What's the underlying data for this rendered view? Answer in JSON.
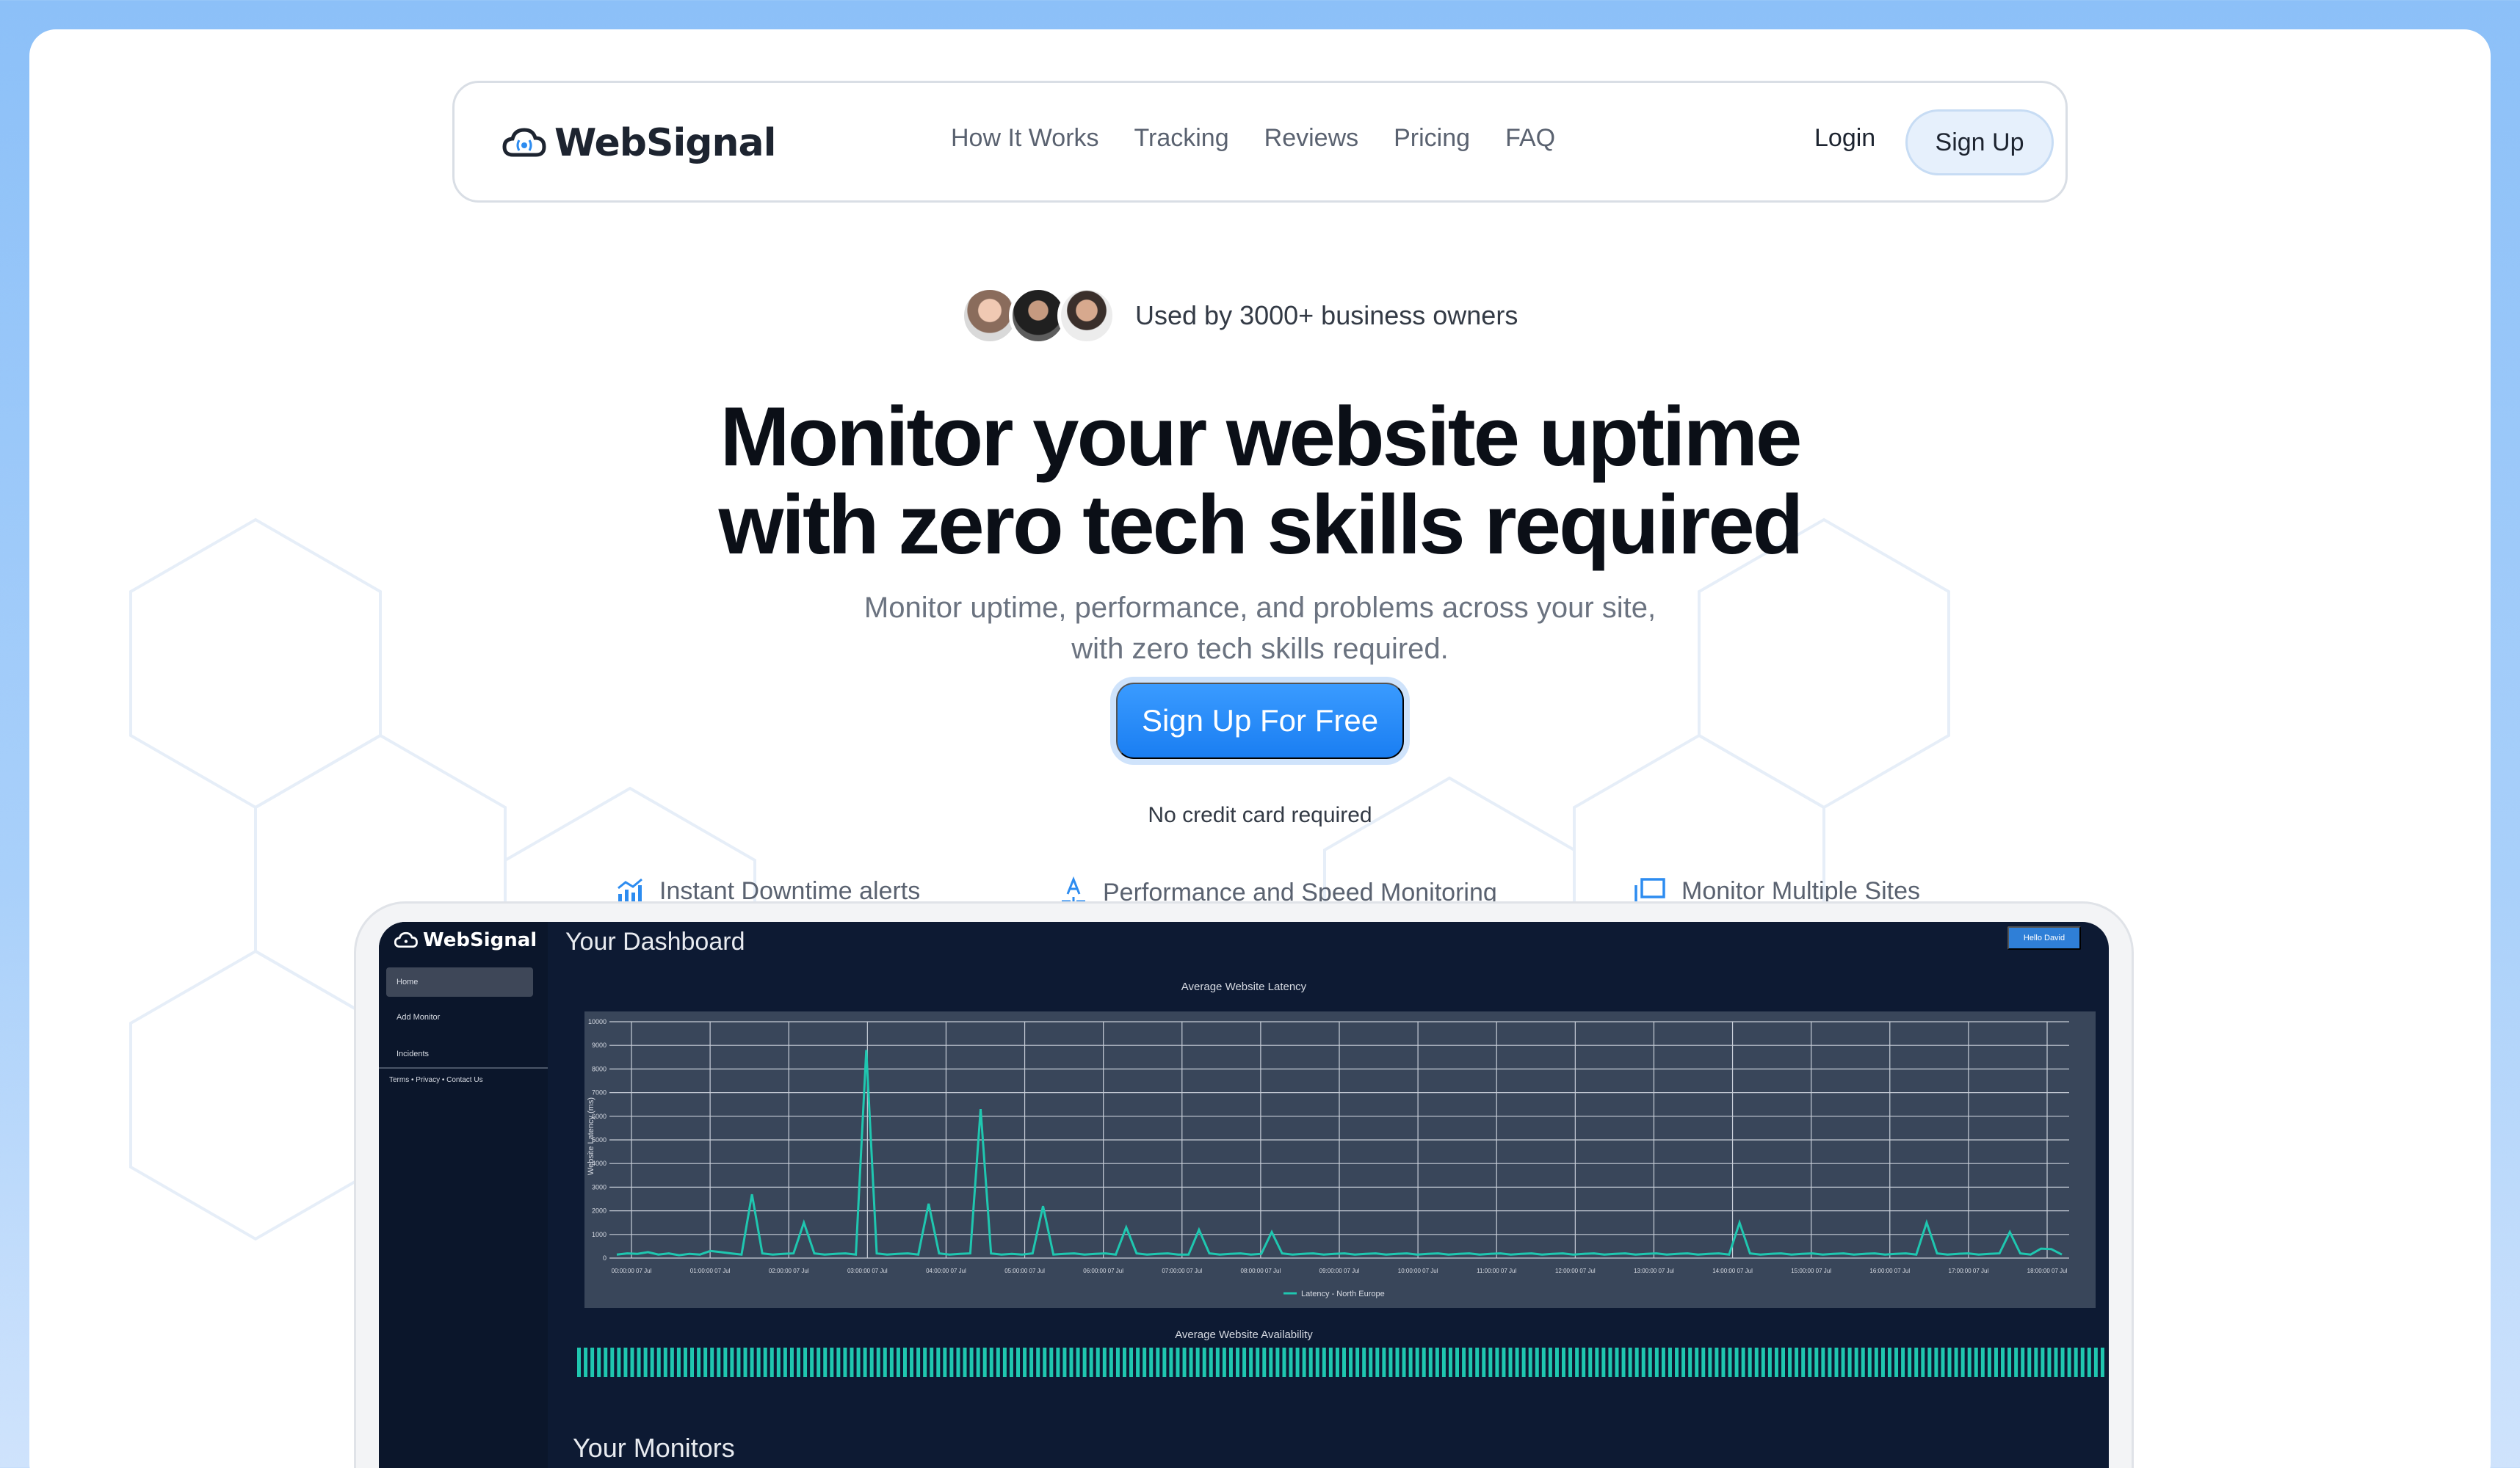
{
  "brand": {
    "name": "WebSignal"
  },
  "nav": {
    "links": [
      "How It Works",
      "Tracking",
      "Reviews",
      "Pricing",
      "FAQ"
    ],
    "login": "Login",
    "signup": "Sign Up"
  },
  "hero": {
    "social_proof": "Used by 3000+ business owners",
    "headline_line1": "Monitor your website uptime",
    "headline_line2": "with zero tech skills required",
    "subhead": "Monitor uptime, performance, and problems across your site, with zero tech skills required.",
    "cta": "Sign Up For Free",
    "cta_note": "No credit card required"
  },
  "features": [
    {
      "icon": "chart-bar-icon",
      "label": "Instant Downtime alerts"
    },
    {
      "icon": "speed-icon",
      "label": "Performance and Speed Monitoring"
    },
    {
      "icon": "windows-icon",
      "label": "Monitor Multiple Sites"
    }
  ],
  "dashboard": {
    "logo": "WebSignal",
    "title": "Your Dashboard",
    "hello": "Hello David",
    "sidebar": [
      "Home",
      "Add Monitor",
      "Incidents"
    ],
    "footer_links": "Terms • Privacy • Contact Us",
    "availability_title": "Average Website Availability",
    "monitors_title": "Your Monitors"
  },
  "colors": {
    "accent": "#1a7ef2",
    "line": "#1fc7b0",
    "dashboard_bg": "#0d1a33"
  },
  "chart_data": {
    "type": "line",
    "title": "Average Website Latency",
    "ylabel": "Website Latency (ms)",
    "xlabel": "",
    "ylim": [
      0,
      10000
    ],
    "yticks": [
      0,
      1000,
      2000,
      3000,
      4000,
      5000,
      6000,
      7000,
      8000,
      9000,
      10000
    ],
    "categories": [
      "00:00:00 07 Jul",
      "01:00:00 07 Jul",
      "02:00:00 07 Jul",
      "03:00:00 07 Jul",
      "04:00:00 07 Jul",
      "05:00:00 07 Jul",
      "06:00:00 07 Jul",
      "07:00:00 07 Jul",
      "08:00:00 07 Jul",
      "09:00:00 07 Jul",
      "10:00:00 07 Jul",
      "11:00:00 07 Jul",
      "12:00:00 07 Jul",
      "13:00:00 07 Jul",
      "14:00:00 07 Jul",
      "15:00:00 07 Jul",
      "16:00:00 07 Jul",
      "17:00:00 07 Jul",
      "18:00:00 07 Jul"
    ],
    "series": [
      {
        "name": "Latency - North Europe",
        "values": [
          150,
          200,
          180,
          250,
          150,
          200,
          120,
          180,
          150,
          300,
          250,
          200,
          150,
          2700,
          200,
          150,
          180,
          200,
          1500,
          200,
          150,
          180,
          200,
          150,
          8800,
          200,
          150,
          180,
          200,
          150,
          2300,
          200,
          150,
          180,
          200,
          6300,
          200,
          150,
          180,
          150,
          200,
          2200,
          150,
          180,
          200,
          150,
          180,
          200,
          150,
          1300,
          200,
          150,
          180,
          200,
          150,
          150,
          1200,
          200,
          150,
          180,
          200,
          150,
          180,
          1100,
          200,
          150,
          180,
          200,
          150,
          180,
          200,
          150,
          180,
          200,
          150,
          180,
          200,
          150,
          180,
          200,
          150,
          180,
          200,
          150,
          180,
          200,
          150,
          180,
          200,
          150,
          180,
          200,
          150,
          180,
          200,
          150,
          180,
          200,
          150,
          180,
          200,
          150,
          180,
          200,
          150,
          180,
          200,
          150,
          1500,
          200,
          150,
          180,
          200,
          150,
          180,
          200,
          150,
          180,
          200,
          150,
          180,
          200,
          150,
          180,
          200,
          150,
          1500,
          200,
          150,
          180,
          200,
          150,
          180,
          200,
          1100,
          200,
          150,
          400,
          380,
          150
        ]
      }
    ],
    "grid": true,
    "legend": "bottom"
  }
}
